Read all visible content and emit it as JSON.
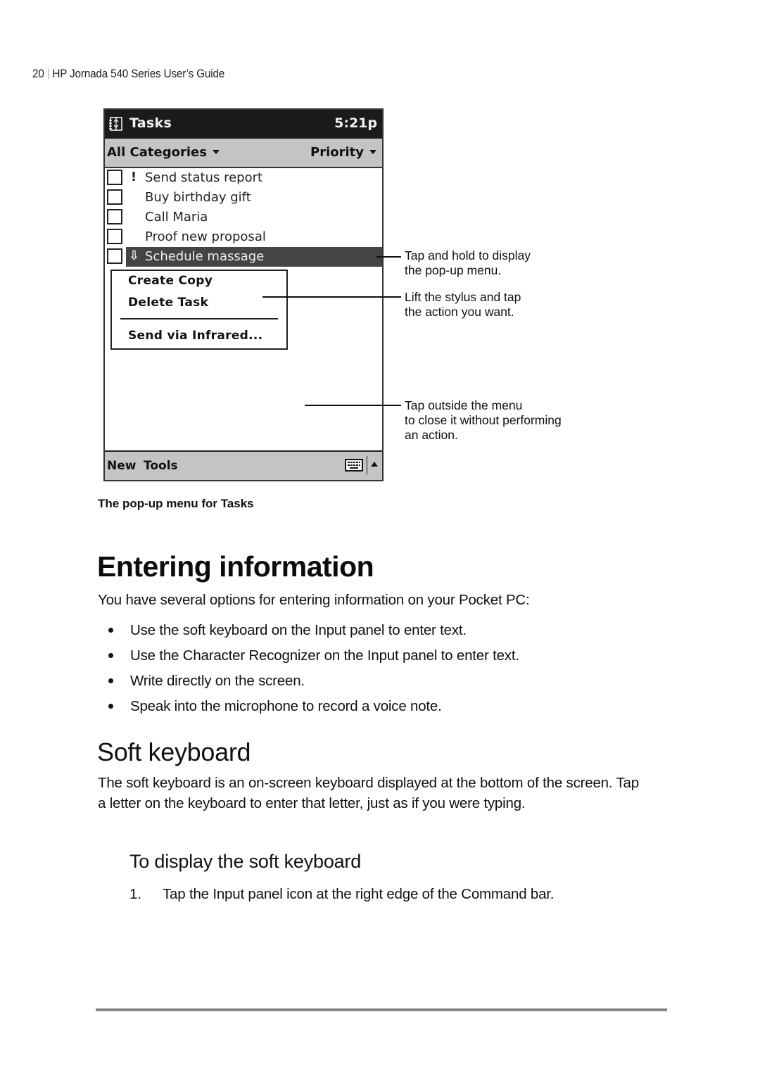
{
  "running_header": {
    "page_number": "20",
    "guide_title": "HP Jornada 540 Series User’s Guide"
  },
  "device_screenshot": {
    "titlebar": {
      "app_icon": "tasks-app-icon",
      "title": "Tasks",
      "clock": "5:21p"
    },
    "filterbar": {
      "category_filter": "All Categories",
      "sort_by": "Priority"
    },
    "tasks": [
      {
        "label": "Send status report",
        "priority_icon": "!",
        "priority": "high",
        "checked": false,
        "selected": false
      },
      {
        "label": "Buy birthday gift",
        "priority_icon": "",
        "priority": "normal",
        "checked": false,
        "selected": false
      },
      {
        "label": "Call Maria",
        "priority_icon": "",
        "priority": "normal",
        "checked": false,
        "selected": false
      },
      {
        "label": "Proof new proposal",
        "priority_icon": "",
        "priority": "normal",
        "checked": false,
        "selected": false
      },
      {
        "label": "Schedule massage",
        "priority_icon": "⇩",
        "priority": "low",
        "checked": false,
        "selected": true
      }
    ],
    "popup_menu": {
      "items": [
        "Create Copy",
        "Delete Task",
        "Send via Infrared..."
      ]
    },
    "command_bar": {
      "menus": [
        "New",
        "Tools"
      ],
      "input_panel_icon": "keyboard-icon",
      "input_toggle_icon": "up-arrow-icon"
    }
  },
  "callouts": [
    {
      "line1": "Tap and hold to display",
      "line2": "the pop-up menu."
    },
    {
      "line1": "Lift the stylus and tap",
      "line2": "the action you want."
    },
    {
      "line1": "Tap outside the menu",
      "line2": "to close it without performing",
      "line3": "an action."
    }
  ],
  "figure_caption": "The pop-up menu for Tasks",
  "section": {
    "heading": "Entering information",
    "intro": "You have several options for entering information on your Pocket PC:",
    "bullets": [
      "Use the soft keyboard on the Input panel to enter text.",
      "Use the Character Recognizer on the Input panel to enter text.",
      "Write directly on the screen.",
      "Speak into the microphone to record a voice note."
    ]
  },
  "subsection": {
    "heading": "Soft keyboard",
    "paragraph": "The soft keyboard is an on-screen keyboard displayed at the bottom of the screen. Tap a letter on the keyboard to enter that letter, just as if you were typing.",
    "procedure_heading": "To display the soft keyboard",
    "steps": [
      {
        "number": "1.",
        "text": "Tap the Input panel icon at the right edge of the Command bar."
      }
    ]
  },
  "colors": {
    "titlebar_bg": "#1b1b1b",
    "bar_gray": "#c4c4c4",
    "selection_bg": "#444444",
    "footer_rule": "#858585"
  }
}
